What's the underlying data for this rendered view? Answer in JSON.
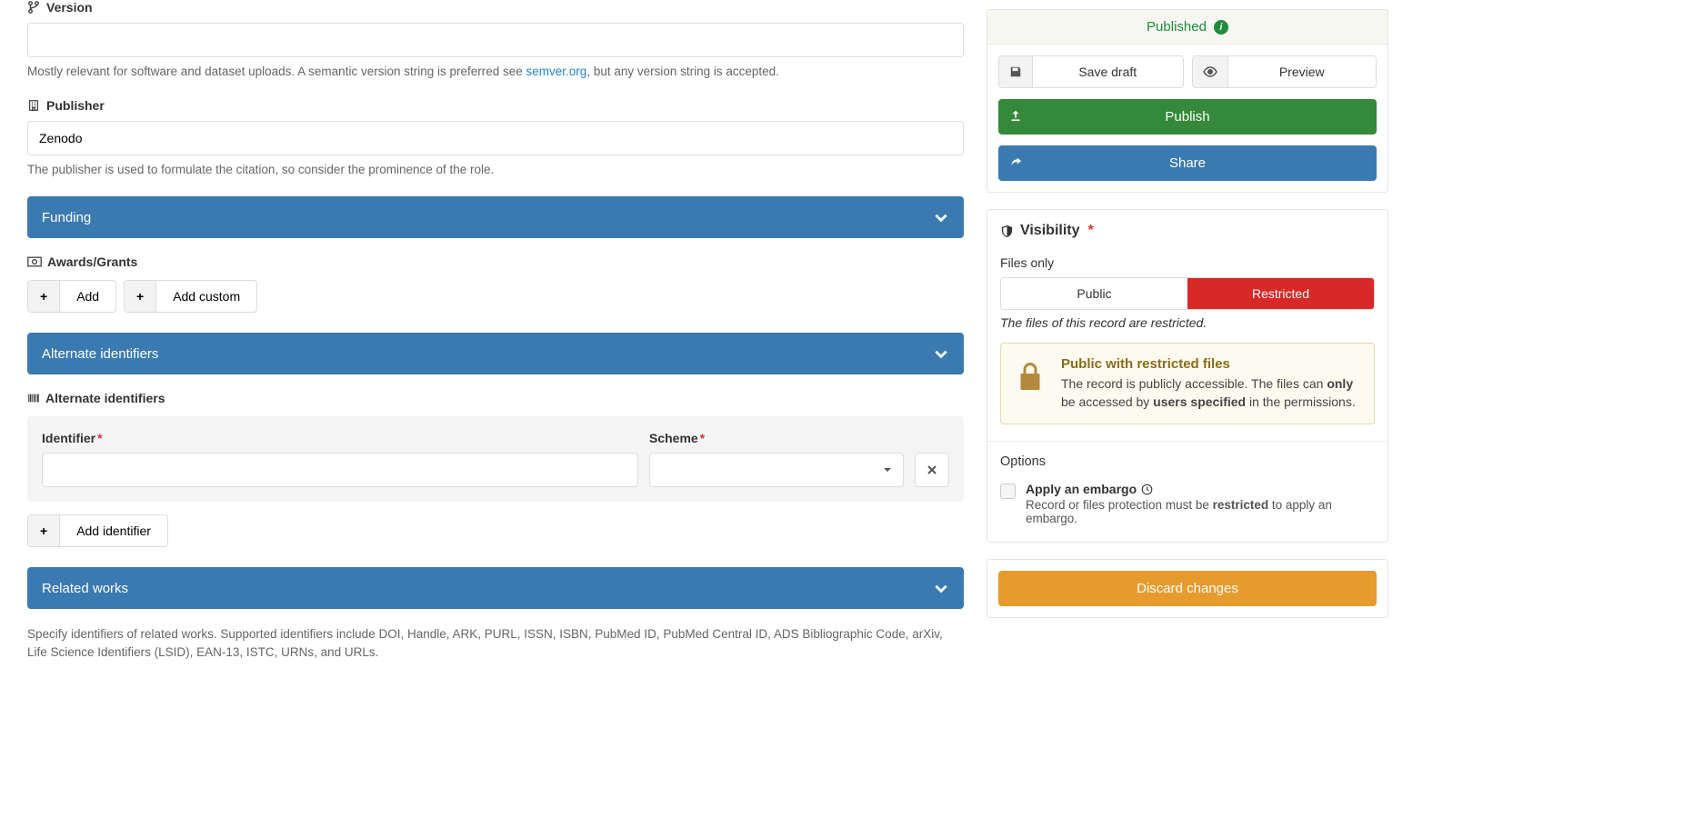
{
  "main": {
    "version": {
      "label": "Version",
      "value": "",
      "help_pre": "Mostly relevant for software and dataset uploads. A semantic version string is preferred see ",
      "help_link": "semver.org",
      "help_post": ", but any version string is accepted."
    },
    "publisher": {
      "label": "Publisher",
      "value": "Zenodo",
      "help": "The publisher is used to formulate the citation, so consider the prominence of the role."
    },
    "funding": {
      "header": "Funding",
      "awards_label": "Awards/Grants",
      "add_label": "Add",
      "add_custom_label": "Add custom"
    },
    "alt_ids": {
      "header": "Alternate identifiers",
      "sub_label": "Alternate identifiers",
      "identifier_label": "Identifier",
      "scheme_label": "Scheme",
      "add_label": "Add identifier"
    },
    "related": {
      "header": "Related works",
      "help": "Specify identifiers of related works. Supported identifiers include DOI, Handle, ARK, PURL, ISSN, ISBN, PubMed ID, PubMed Central ID, ADS Bibliographic Code, arXiv, Life Science Identifiers (LSID), EAN-13, ISTC, URNs, and URLs."
    }
  },
  "sidebar": {
    "status": "Published",
    "save_draft": "Save draft",
    "preview": "Preview",
    "publish": "Publish",
    "share": "Share",
    "visibility": {
      "title": "Visibility",
      "files_only": "Files only",
      "public": "Public",
      "restricted": "Restricted",
      "note": "The files of this record are restricted.",
      "box_title": "Public with restricted files",
      "box_text_1": "The record is publicly accessible. The files can ",
      "box_only": "only",
      "box_text_2": " be accessed by ",
      "box_users": "users specified",
      "box_text_3": " in the permissions."
    },
    "options": {
      "title": "Options",
      "embargo_title": "Apply an embargo",
      "embargo_text_1": "Record or files protection must be ",
      "embargo_bold": "restricted",
      "embargo_text_2": " to apply an embargo."
    },
    "discard": "Discard changes"
  }
}
